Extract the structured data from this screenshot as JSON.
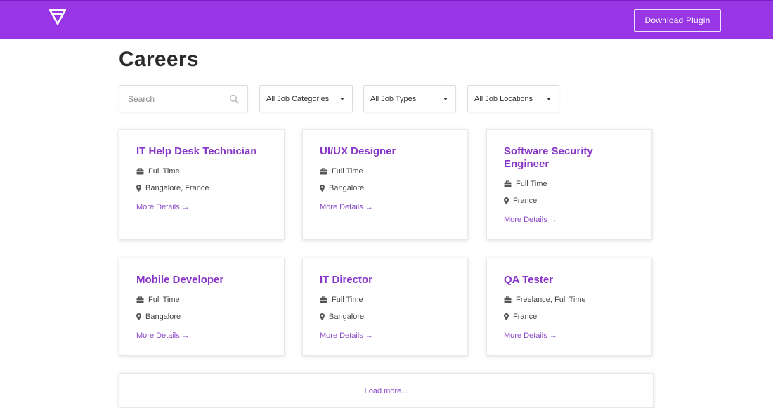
{
  "header": {
    "brand_color": "#9836e6",
    "logo_icon": "logo-icon",
    "download_label": "Download Plugin"
  },
  "page": {
    "title": "Careers"
  },
  "filters": {
    "search_placeholder": "Search",
    "search_value": "",
    "categories_selected": "All Job Categories",
    "types_selected": "All Job Types",
    "locations_selected": "All Job Locations"
  },
  "jobs": [
    {
      "title": "IT Help Desk Technician",
      "type": "Full Time",
      "location": "Bangalore, France",
      "more": "More Details →"
    },
    {
      "title": "UI/UX Designer",
      "type": "Full Time",
      "location": "Bangalore",
      "more": "More Details →"
    },
    {
      "title": "Software Security Engineer",
      "type": "Full Time",
      "location": "France",
      "more": "More Details →"
    },
    {
      "title": "Mobile Developer",
      "type": "Full Time",
      "location": "Bangalore",
      "more": "More Details →"
    },
    {
      "title": "IT Director",
      "type": "Full Time",
      "location": "Bangalore",
      "more": "More Details →"
    },
    {
      "title": "QA Tester",
      "type": "Freelance, Full Time",
      "location": "France",
      "more": "More Details →"
    }
  ],
  "load_more_label": "Load more...",
  "colors": {
    "accent": "#8735c8",
    "link": "#8b48c7"
  }
}
